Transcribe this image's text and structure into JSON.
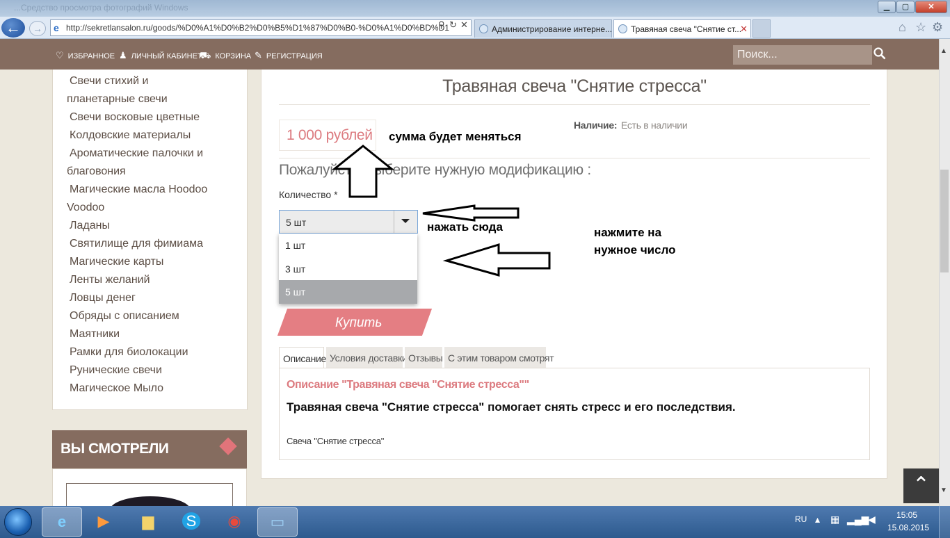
{
  "browser": {
    "window_title": "...Средство просмотра фотографий Windows",
    "address": "http://sekretlansalon.ru/goods/%D0%A1%D0%B2%D0%B5%D1%87%D0%B0-%D0%A1%D0%BD%D1",
    "tabs": [
      {
        "label": "Администрирование интерне..."
      },
      {
        "label": "Травяная свеча \"Снятие ст..."
      }
    ]
  },
  "site_nav": {
    "links": [
      {
        "label": "ИЗБРАННОЕ",
        "icon": "heart-icon"
      },
      {
        "label": "ЛИЧНЫЙ КАБИНЕТ",
        "icon": "user-icon"
      },
      {
        "label": "КОРЗИНА",
        "icon": "cart-icon"
      },
      {
        "label": "РЕГИСТРАЦИЯ",
        "icon": "feather-icon"
      }
    ],
    "search_placeholder": "Поиск..."
  },
  "sidebar": {
    "categories": [
      "Свечи стихий и планетарные свечи",
      "Свечи восковые цветные",
      "Колдовские материалы",
      "Ароматические палочки и благовония",
      "Магические масла Hoodoo Voodoo",
      "Ладаны",
      "Святилище для фимиама",
      "Магические карты",
      "Ленты желаний",
      "Ловцы денег",
      "Обряды с описанием",
      "Маятники",
      "Рамки для биолокации",
      "Рунические свечи",
      "Магическое Мыло"
    ],
    "viewed_title": "ВЫ СМОТРЕЛИ"
  },
  "product": {
    "title": "Травяная свеча \"Снятие стресса\"",
    "price": "1 000 рублей",
    "availability_label": "Наличие:",
    "availability_value": "Есть в наличии",
    "modification_prompt": "Пожалуйста, выберите нужную модификацию :",
    "quantity_label": "Количество *",
    "quantity_selected": "5 шт",
    "quantity_options": [
      "1 шт",
      "3 шт",
      "5 шт"
    ],
    "buy_label": "Купить",
    "tabs": [
      "Описание",
      "Условия доставки",
      "Отзывы",
      "С этим товаром смотрят"
    ],
    "description_heading": "Описание \"Травяная свеча \"Снятие стресса\"\"",
    "description_body": "Травяная свеча \"Снятие стресса\" помогает снять стресс и его последствия.",
    "description_small": "Свеча \"Снятие стресса\""
  },
  "annotations": {
    "sum": "сумма будет меняться",
    "click": "нажать сюда",
    "choose_line1": "нажмите на",
    "choose_line2": "нужное число"
  },
  "taskbar": {
    "lang": "RU",
    "time": "15:05",
    "date": "15.08.2015"
  },
  "colors": {
    "brand_brown": "#856c5f",
    "price_pink": "#dc7a7f",
    "buy_button": "#e47e83"
  }
}
